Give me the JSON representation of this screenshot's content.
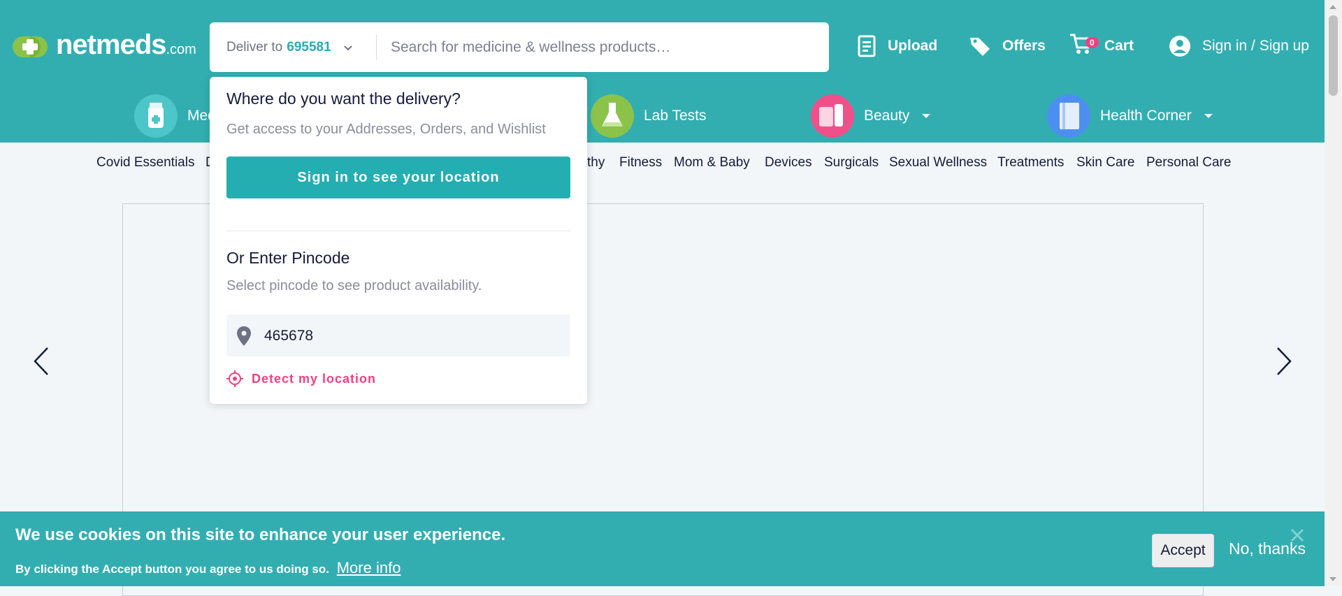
{
  "header": {
    "logo_text": "netmeds",
    "logo_suffix": ".com",
    "deliver_label": "Deliver to",
    "deliver_pincode": "695581",
    "search_placeholder": "Search for medicine & wellness products…",
    "upload_label": "Upload",
    "offers_label": "Offers",
    "cart_label": "Cart",
    "cart_count": "0",
    "signin_label": "Sign in / Sign up"
  },
  "categories": [
    {
      "label": "Med",
      "color": "#4cc6c9"
    },
    {
      "label": "Lab Tests",
      "color": "#8bc34a"
    },
    {
      "label": "Beauty",
      "color": "#f0508a"
    },
    {
      "label": "Health Corner",
      "color": "#4d8ff0"
    }
  ],
  "subnav": [
    "Covid Essentials",
    "D",
    "thy",
    "Fitness",
    "Mom & Baby",
    "Devices",
    "Surgicals",
    "Sexual Wellness",
    "Treatments",
    "Skin Care",
    "Personal Care"
  ],
  "popover": {
    "title": "Where do you want the delivery?",
    "subtitle": "Get access to your Addresses, Orders, and Wishlist",
    "signin_button": "Sign in to see your location",
    "pincode_title": "Or Enter Pincode",
    "pincode_subtitle": "Select pincode to see product availability.",
    "pincode_value": "465678",
    "detect_label": "Detect my location"
  },
  "cookie": {
    "title": "We use cookies on this site to enhance your user experience.",
    "text": "By clicking the Accept button you agree to us doing so.",
    "more_info": "More info",
    "accept": "Accept",
    "no_thanks": "No, thanks"
  },
  "colors": {
    "brand_teal": "#32aeb1",
    "accent_pink": "#ef4281",
    "text_dark": "#151b39"
  },
  "icons": {
    "upload": "prescription-icon",
    "offers": "tag-icon",
    "cart": "cart-icon",
    "account": "user-icon",
    "pin": "map-pin-icon",
    "detect": "crosshair-icon"
  }
}
